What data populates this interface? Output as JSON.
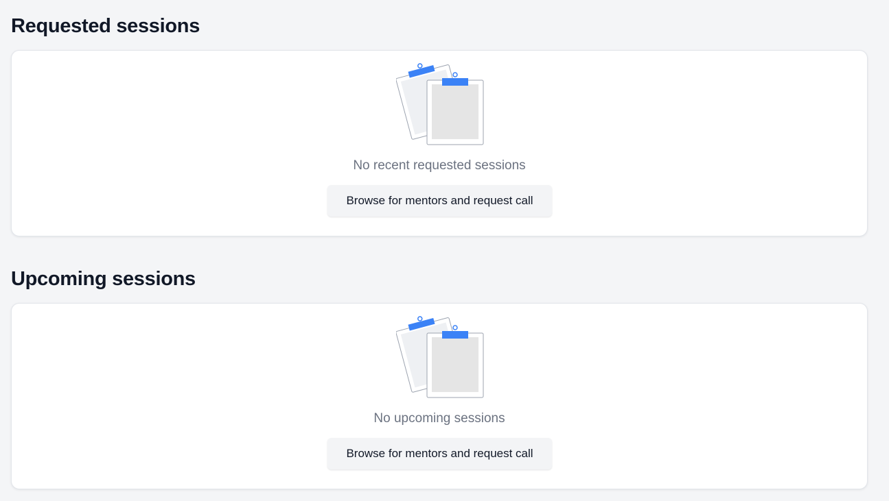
{
  "requested": {
    "title": "Requested sessions",
    "empty_message": "No recent requested sessions",
    "button_label": "Browse for mentors and request call",
    "illustration_icon": "clipboards-icon"
  },
  "upcoming": {
    "title": "Upcoming sessions",
    "empty_message": "No upcoming sessions",
    "button_label": "Browse for mentors and request call",
    "illustration_icon": "clipboards-icon"
  },
  "colors": {
    "page_background": "#f4f5f7",
    "card_background": "#ffffff",
    "accent_blue": "#3b82f6",
    "muted_text": "#6b7280",
    "button_background": "#f3f4f6"
  }
}
